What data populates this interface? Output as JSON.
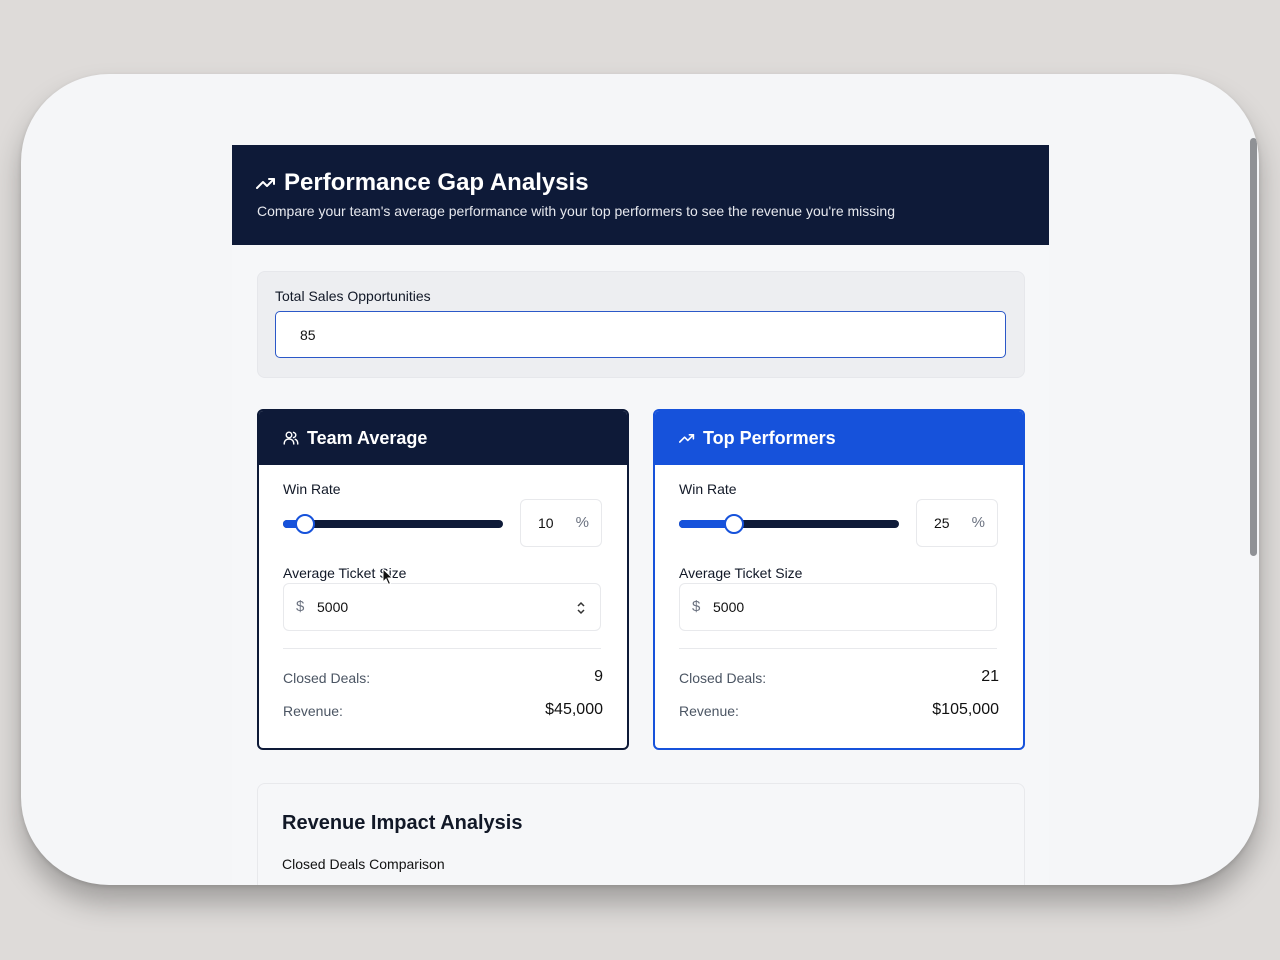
{
  "header": {
    "title": "Performance Gap Analysis",
    "subtitle": "Compare your team's average performance with your top performers to see the revenue you're missing",
    "icon": "trending-up-icon"
  },
  "opportunities": {
    "label": "Total Sales Opportunities",
    "value": "85"
  },
  "team": {
    "title": "Team Average",
    "icon": "users-icon",
    "win_rate_label": "Win Rate",
    "win_rate": "10",
    "win_rate_fraction": 0.1,
    "pct_symbol": "%",
    "ticket_label": "Average Ticket Size",
    "currency_symbol": "$",
    "ticket_value": "5000",
    "closed_label": "Closed Deals:",
    "closed_value": "9",
    "revenue_label": "Revenue:",
    "revenue_value": "$45,000"
  },
  "top": {
    "title": "Top Performers",
    "icon": "trending-up-icon",
    "win_rate_label": "Win Rate",
    "win_rate": "25",
    "win_rate_fraction": 0.25,
    "pct_symbol": "%",
    "ticket_label": "Average Ticket Size",
    "currency_symbol": "$",
    "ticket_value": "5000",
    "closed_label": "Closed Deals:",
    "closed_value": "21",
    "revenue_label": "Revenue:",
    "revenue_value": "$105,000"
  },
  "impact": {
    "title": "Revenue Impact Analysis",
    "subtitle": "Closed Deals Comparison"
  },
  "colors": {
    "navy": "#0e1a38",
    "accent_blue": "#1652db"
  }
}
